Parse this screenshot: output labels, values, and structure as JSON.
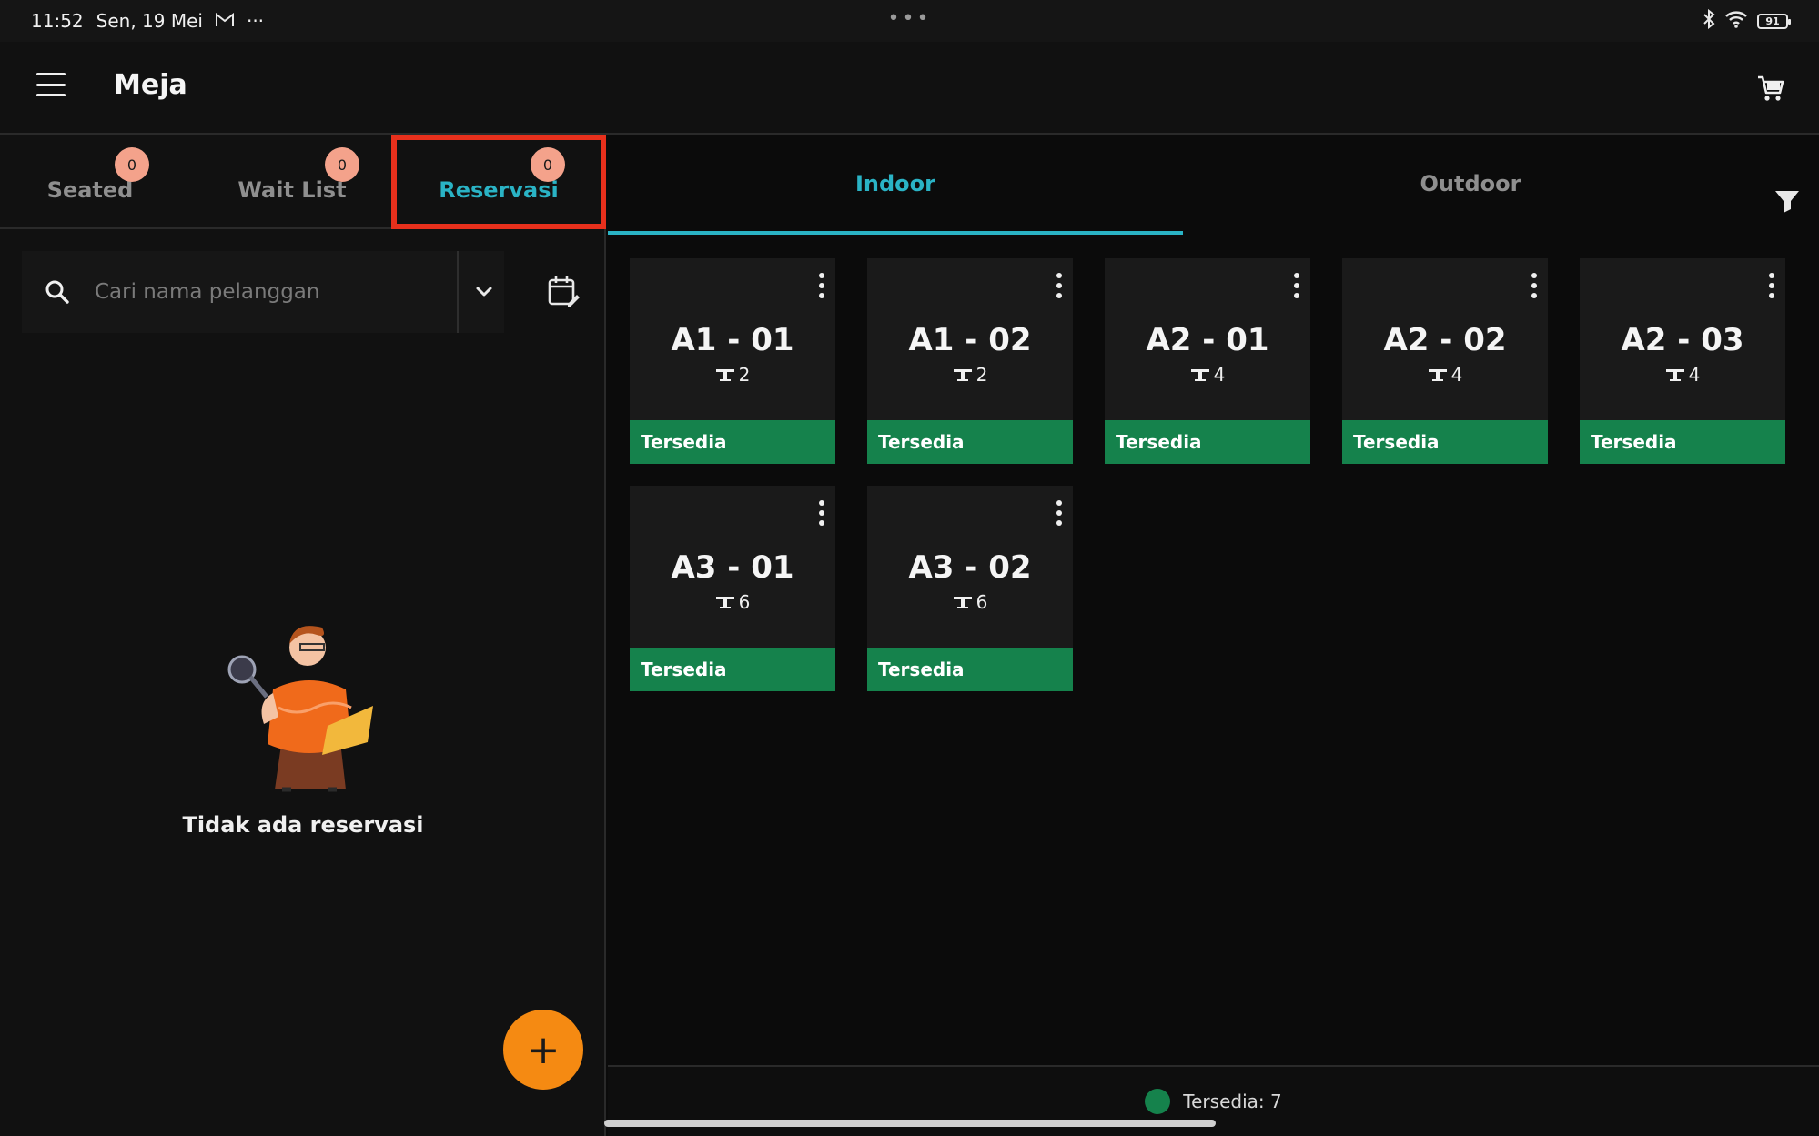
{
  "statusbar": {
    "time": "11:52",
    "date": "Sen, 19 Mei",
    "extra": "···",
    "center_dots": "•••",
    "battery": "91",
    "icons": [
      "gmail-icon",
      "bluetooth-icon",
      "wifi-icon",
      "battery-icon"
    ]
  },
  "appbar": {
    "title": "Meja",
    "icons": [
      "menu-icon",
      "cart-icon"
    ]
  },
  "left_tabs": [
    {
      "label": "Seated",
      "count": "0",
      "active": false
    },
    {
      "label": "Wait List",
      "count": "0",
      "active": false
    },
    {
      "label": "Reservasi",
      "count": "0",
      "active": true
    }
  ],
  "search": {
    "placeholder": "Cari nama pelanggan",
    "value": ""
  },
  "empty_state": {
    "text": "Tidak ada reservasi",
    "illustration": "person-with-magnifier-illustration"
  },
  "fab": {
    "label": "+"
  },
  "area_tabs": [
    {
      "label": "Indoor",
      "active": true
    },
    {
      "label": "Outdoor",
      "active": false
    }
  ],
  "tables": [
    {
      "name": "A1 - 01",
      "seats": "2",
      "status": "Tersedia"
    },
    {
      "name": "A1 - 02",
      "seats": "2",
      "status": "Tersedia"
    },
    {
      "name": "A2 - 01",
      "seats": "4",
      "status": "Tersedia"
    },
    {
      "name": "A2 - 02",
      "seats": "4",
      "status": "Tersedia"
    },
    {
      "name": "A2 - 03",
      "seats": "4",
      "status": "Tersedia"
    },
    {
      "name": "A3 - 01",
      "seats": "6",
      "status": "Tersedia"
    },
    {
      "name": "A3 - 02",
      "seats": "6",
      "status": "Tersedia"
    }
  ],
  "legend": {
    "text": "Tersedia: 7",
    "color": "#15824c"
  },
  "colors": {
    "accent": "#2ab3c5",
    "available": "#15824c",
    "fab": "#f58a12",
    "badge": "#f4a28b",
    "highlight": "#e8301c"
  }
}
